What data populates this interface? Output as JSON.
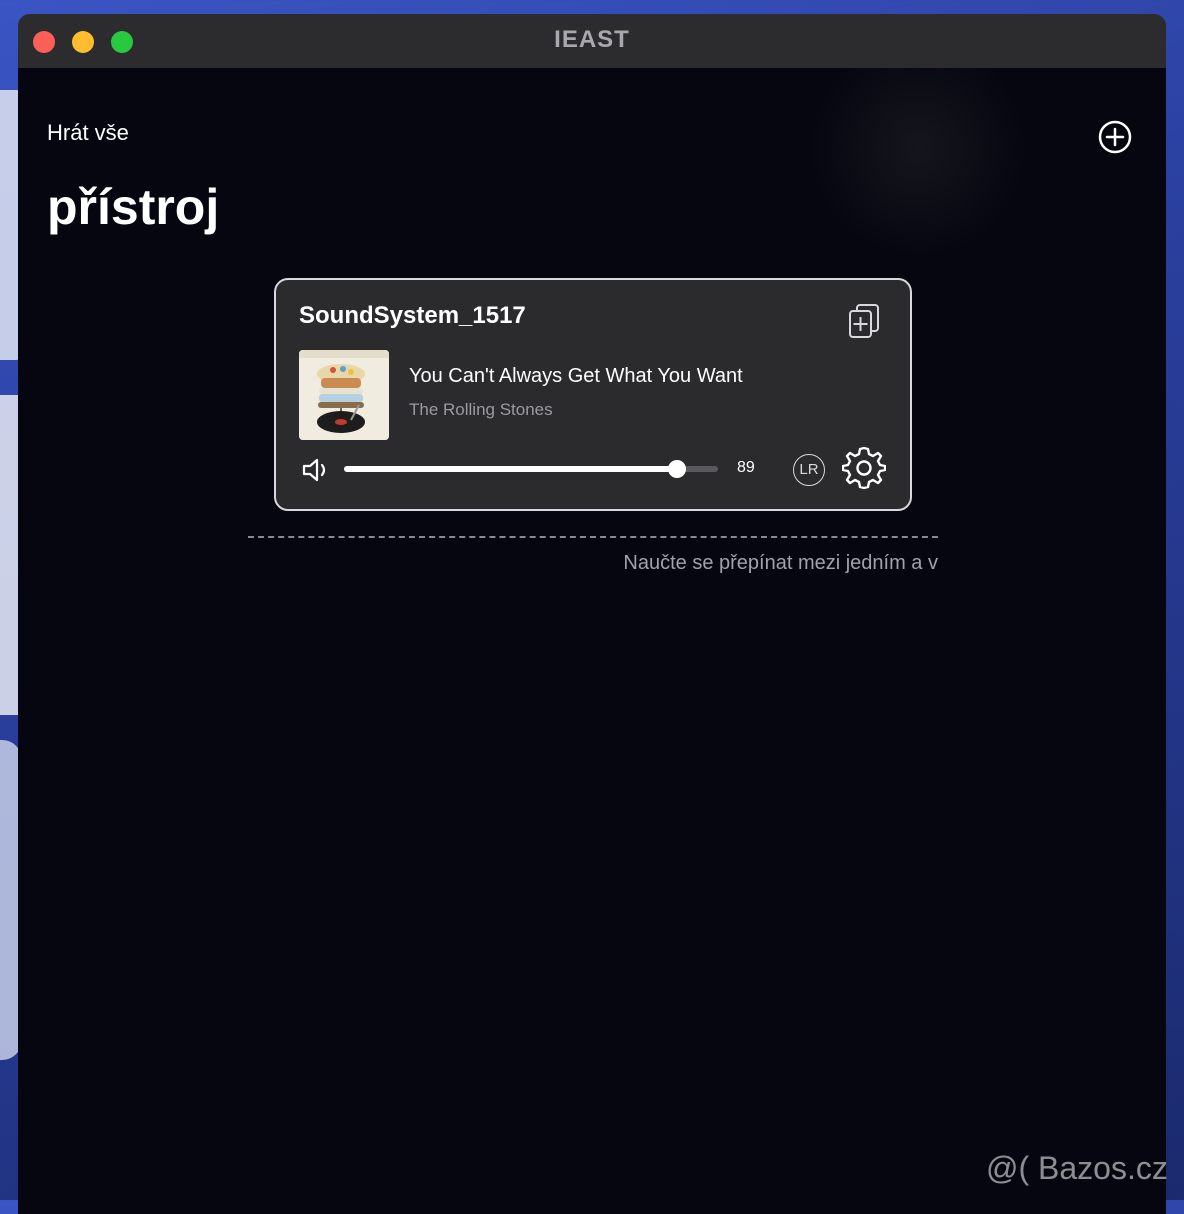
{
  "window": {
    "title": "IEAST"
  },
  "header": {
    "play_all_label": "Hrát vše",
    "page_title": "přístroj"
  },
  "device": {
    "name": "SoundSystem_1517",
    "now_playing": {
      "title": "You Can't Always Get What You Want",
      "artist": "The Rolling Stones"
    },
    "volume": 89,
    "channel_label": "LR"
  },
  "hint_text": "Naučte se přepínat mezi jedním a v",
  "watermark": "@( Bazos.cz",
  "icons": {
    "add": "plus-circle-icon",
    "group": "add-group-icon",
    "volume": "speaker-icon",
    "settings": "gear-icon"
  },
  "colors": {
    "background": "#05060f",
    "card": "#2b2b2d",
    "accent": "#ffffff",
    "traffic_red": "#fe5f57",
    "traffic_yellow": "#febc2e",
    "traffic_green": "#28c840"
  }
}
